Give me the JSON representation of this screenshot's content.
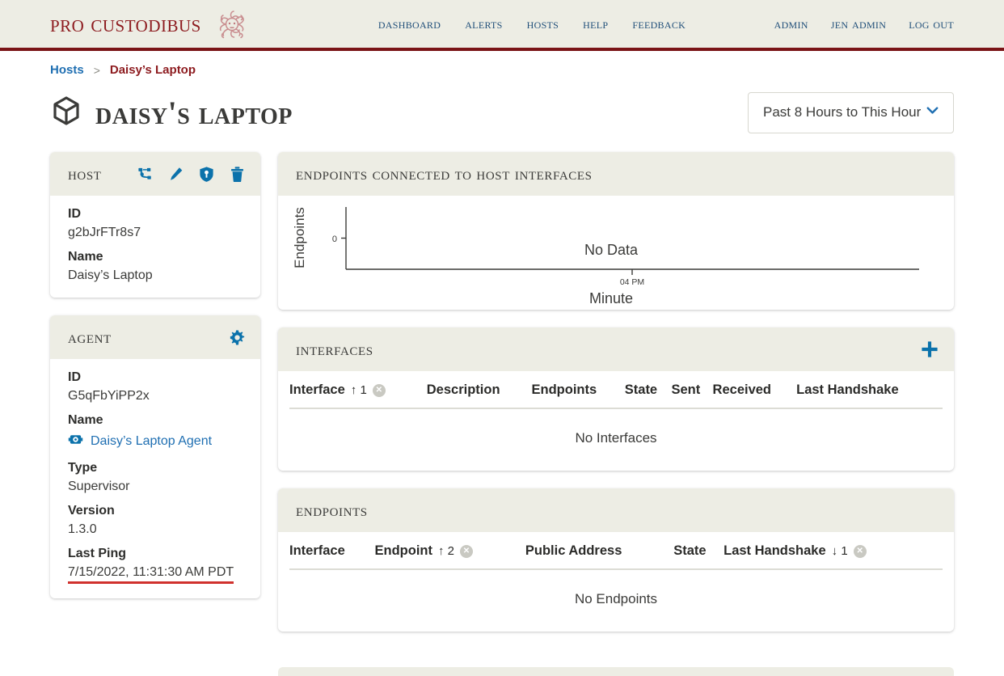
{
  "brand": {
    "name": "Pro Custodibus",
    "logo_icon": "medusa-head-icon"
  },
  "nav": {
    "main": [
      {
        "label": "Dashboard",
        "name": "dashboard"
      },
      {
        "label": "Alerts",
        "name": "alerts"
      },
      {
        "label": "Hosts",
        "name": "hosts"
      },
      {
        "label": "Help",
        "name": "help"
      },
      {
        "label": "Feedback",
        "name": "feedback"
      }
    ],
    "user": [
      {
        "label": "Admin",
        "name": "admin"
      },
      {
        "label": "Jen Admin",
        "name": "jen-admin"
      },
      {
        "label": "Log Out",
        "name": "log-out"
      }
    ]
  },
  "breadcrumb": {
    "root": "Hosts",
    "separator": ">",
    "current": "Daisy’s Laptop"
  },
  "page": {
    "title": "Daisy's Laptop",
    "title_icon": "cube-icon"
  },
  "range_select": {
    "value": "Past 8 Hours to This Hour",
    "chevron_icon": "chevron-down-icon"
  },
  "host_card": {
    "title": "Host",
    "actions": [
      {
        "name": "network-icon",
        "label": "Network"
      },
      {
        "name": "pencil-icon",
        "label": "Edit"
      },
      {
        "name": "shield-key-icon",
        "label": "Security"
      },
      {
        "name": "trash-icon",
        "label": "Delete"
      }
    ],
    "fields": [
      {
        "label": "ID",
        "value": "g2bJrFTr8s7"
      },
      {
        "label": "Name",
        "value": "Daisy’s Laptop"
      }
    ]
  },
  "agent_card": {
    "title": "Agent",
    "actions": [
      {
        "name": "gear-icon",
        "label": "Settings"
      }
    ],
    "id_label": "ID",
    "id_value": "G5qFbYiPP2x",
    "name_label": "Name",
    "name_value": "Daisy’s Laptop Agent",
    "name_icon": "robot-icon",
    "type_label": "Type",
    "type_value": "Supervisor",
    "version_label": "Version",
    "version_value": "1.3.0",
    "last_ping_label": "Last Ping",
    "last_ping_value": "7/15/2022, 11:31:30 AM PDT"
  },
  "chart_panel": {
    "title": "Endpoints Connected to Host Interfaces"
  },
  "chart_data": {
    "type": "line",
    "title": "Endpoints Connected to Host Interfaces",
    "xlabel": "Minute",
    "ylabel": "Endpoints",
    "x_tick_labels": [
      "04 PM"
    ],
    "y_tick_labels": [
      "0"
    ],
    "ylim": [
      0,
      1
    ],
    "series": [],
    "values": [],
    "grid": false,
    "legend": "none",
    "empty_message": "No Data"
  },
  "interfaces_panel": {
    "title": "Interfaces",
    "add_icon": "plus-icon",
    "columns": [
      {
        "label": "Interface",
        "sort": "↑ 1",
        "clearable": true
      },
      {
        "label": "Description",
        "sort": "",
        "clearable": false
      },
      {
        "label": "Endpoints",
        "sort": "",
        "clearable": false
      },
      {
        "label": "State",
        "sort": "",
        "clearable": false
      },
      {
        "label": "Sent",
        "sort": "",
        "clearable": false
      },
      {
        "label": "Received",
        "sort": "",
        "clearable": false
      },
      {
        "label": "Last Handshake",
        "sort": "",
        "clearable": false
      }
    ],
    "rows": [],
    "empty_message": "No Interfaces"
  },
  "endpoints_panel": {
    "title": "Endpoints",
    "columns": [
      {
        "label": "Interface",
        "sort": "",
        "clearable": false
      },
      {
        "label": "Endpoint",
        "sort": "↑ 2",
        "clearable": true
      },
      {
        "label": "Public Address",
        "sort": "",
        "clearable": false
      },
      {
        "label": "State",
        "sort": "",
        "clearable": false
      },
      {
        "label": "Last Handshake",
        "sort": "↓ 1",
        "clearable": true
      }
    ],
    "rows": [],
    "empty_message": "No Endpoints"
  },
  "colors": {
    "brand_red": "#8d1b1f",
    "header_bg": "#edede4",
    "header_rule": "#7a1416",
    "link_blue": "#1f6fb2",
    "icon_blue": "#0b72ab",
    "alert_red": "#d0312d",
    "text_dark": "#3b3b39"
  }
}
